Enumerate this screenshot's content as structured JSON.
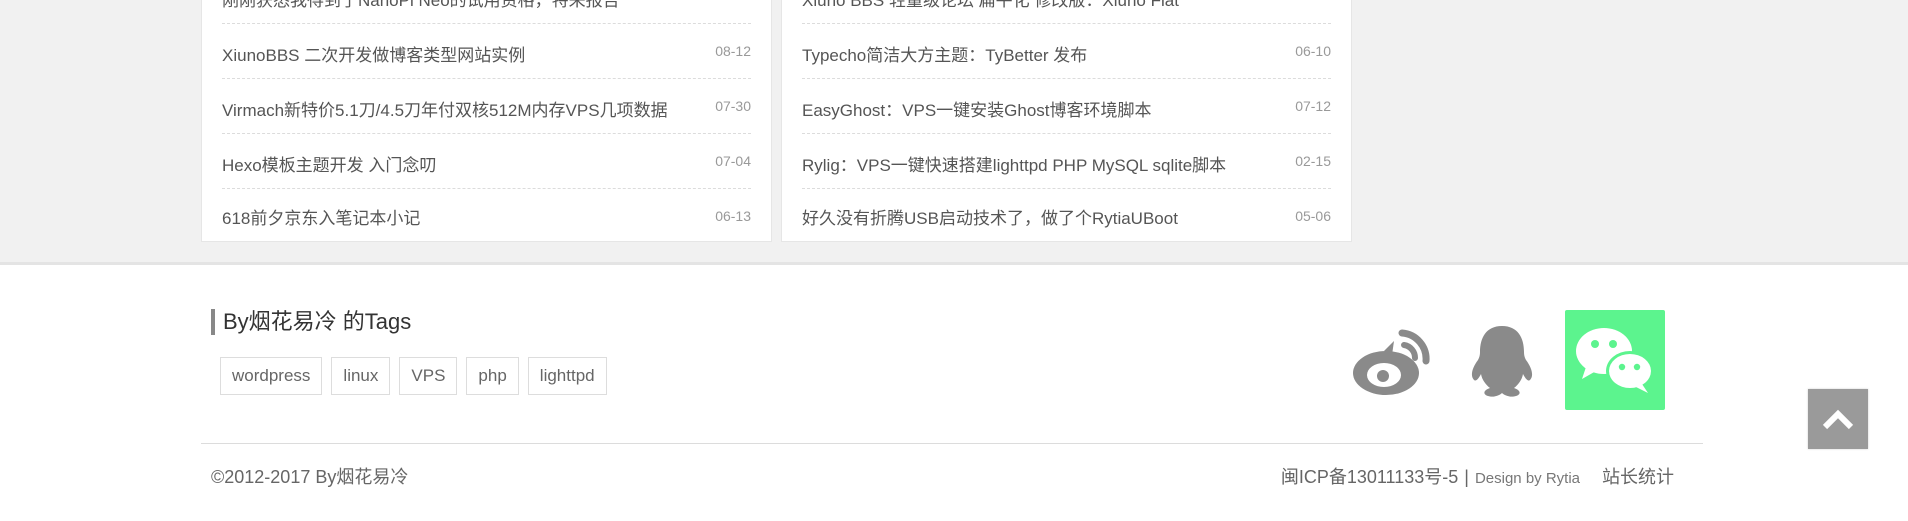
{
  "left_posts": [
    {
      "title": "刚刚获悉我得到了NanoPi Neo的试用资格，特来报告",
      "date": ""
    },
    {
      "title": "XiunoBBS 二次开发做博客类型网站实例",
      "date": "08-12"
    },
    {
      "title": "Virmach新特价5.1刀/4.5刀年付双核512M内存VPS几项数据",
      "date": "07-30"
    },
    {
      "title": "Hexo模板主题开发 入门念叨",
      "date": "07-04"
    },
    {
      "title": "618前夕京东入笔记本小记",
      "date": "06-13"
    }
  ],
  "right_posts": [
    {
      "title": "Xiuno BBS 轻量级论坛 扁平化 修改版：Xiuno Flat",
      "date": ""
    },
    {
      "title": "Typecho简洁大方主题：TyBetter 发布",
      "date": "06-10"
    },
    {
      "title": "EasyGhost：VPS一键安装Ghost博客环境脚本",
      "date": "07-12"
    },
    {
      "title": "Rylig：VPS一键快速搭建lighttpd PHP MySQL sqlite脚本",
      "date": "02-15"
    },
    {
      "title": "好久没有折腾USB启动技术了，做了个RytiaUBoot",
      "date": "05-06"
    }
  ],
  "footer": {
    "tags_title": "By烟花易冷 的Tags",
    "tags": [
      "wordpress",
      "linux",
      "VPS",
      "php",
      "lighttpd"
    ],
    "social": {
      "weibo_icon": "weibo-icon",
      "qq_icon": "qq-icon",
      "wechat_icon": "wechat-icon",
      "wechat_color": "#5cf48e"
    },
    "copyright": "©2012-2017 By烟花易冷",
    "icp": "闽ICP备13011133号-5",
    "separator": "|",
    "design": "Design by Rytia",
    "stats": "站长统计"
  },
  "back_to_top_icon": "chevron-up-icon"
}
